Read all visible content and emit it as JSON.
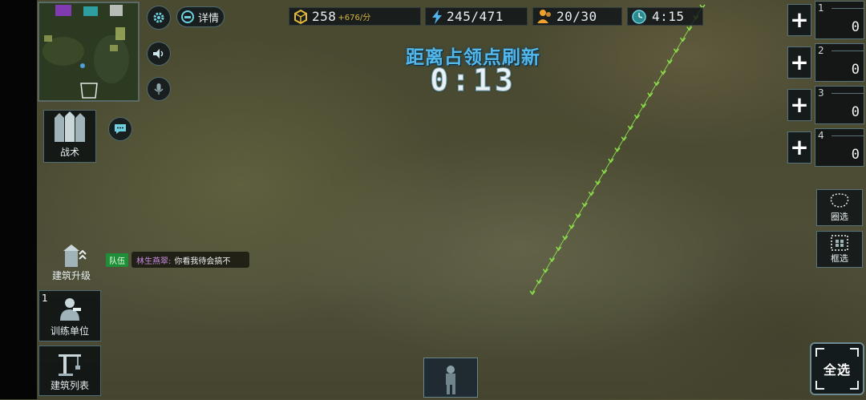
{
  "resources": {
    "gold": {
      "value": "258",
      "rate": "+676/分",
      "icon": "gold-cube-icon"
    },
    "energy": {
      "value": "245/471",
      "icon": "lightning-icon"
    },
    "population": {
      "value": "20/30",
      "icon": "population-icon"
    },
    "clock": {
      "value": "4:15",
      "icon": "clock-icon"
    }
  },
  "top_buttons": {
    "details_label": "详情"
  },
  "banner": {
    "title": "距离占领点刷新",
    "timer": "0:13"
  },
  "left_panel": {
    "tactics_label": "战术",
    "building_upgrade_label": "建筑升级",
    "train_units_label": "训练单位",
    "train_units_badge": "1",
    "building_list_label": "建筑列表"
  },
  "chat": {
    "tag": "队伍",
    "name": "林生燕翠:",
    "message": "你看我待会搞不"
  },
  "control_groups": [
    {
      "number": "1",
      "count": "0"
    },
    {
      "number": "2",
      "count": "0"
    },
    {
      "number": "3",
      "count": "0"
    },
    {
      "number": "4",
      "count": "0"
    }
  ],
  "right_tools": {
    "lasso_label": "圈选",
    "box_label": "框选",
    "select_all_label": "全选"
  },
  "colors": {
    "accent_blue": "#55b8ea",
    "gold_rate": "#d9b640",
    "path_green": "#8be04a",
    "team_tag": "#1f8e38"
  }
}
